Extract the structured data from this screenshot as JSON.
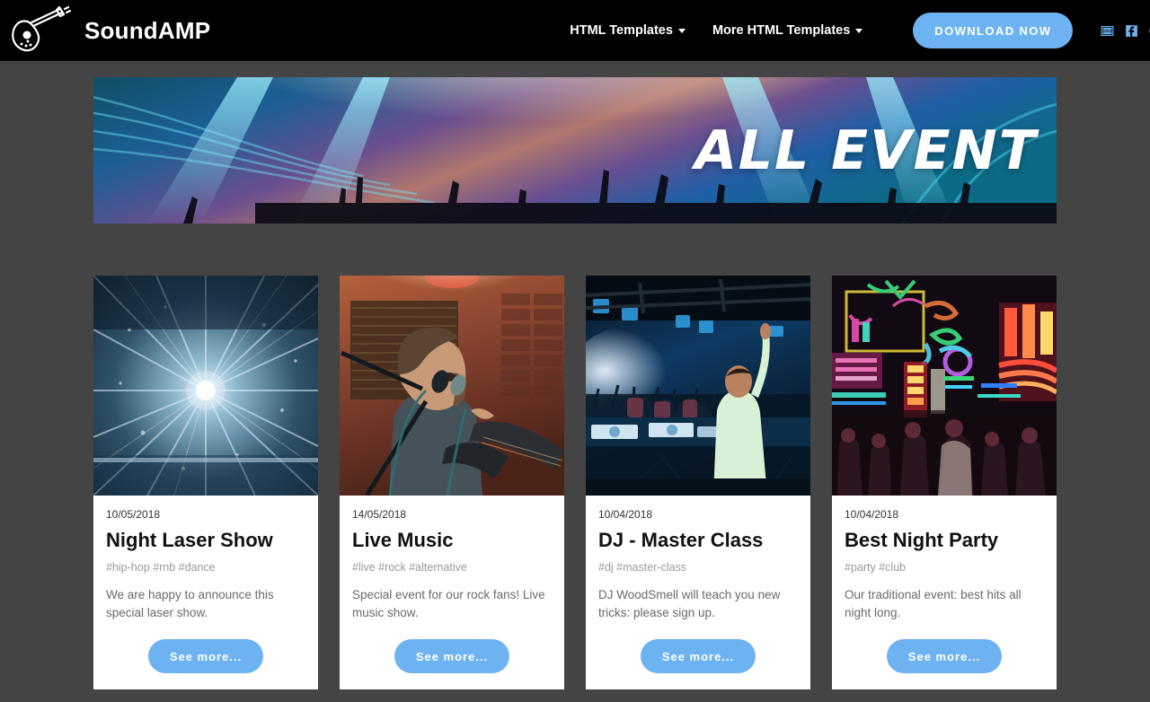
{
  "header": {
    "logo_icon": "guitar-icon",
    "brand": "SoundAMP",
    "nav": [
      {
        "label": "HTML Templates",
        "caret": true
      },
      {
        "label": "More HTML Templates",
        "caret": true
      }
    ],
    "download_label": "DOWNLOAD NOW",
    "socials": [
      {
        "name": "youtube-icon"
      },
      {
        "name": "facebook-icon"
      },
      {
        "name": "google-plus-icon"
      },
      {
        "name": "linkedin-icon"
      },
      {
        "name": "pinterest-icon"
      },
      {
        "name": "instagram-icon"
      },
      {
        "name": "twitter-icon"
      }
    ]
  },
  "hero": {
    "title": "ALL EVENT"
  },
  "cards": [
    {
      "date": "10/05/2018",
      "title": "Night Laser Show",
      "tags": "#hip-hop #rnb #dance",
      "desc": "We are happy to announce this special laser show.",
      "button": "See more...",
      "image_alt": "laser-light-burst-photo"
    },
    {
      "date": "14/05/2018",
      "title": "Live Music",
      "tags": "#live #rock #alternative",
      "desc": "Special event for our rock fans! Live music show.",
      "button": "See more...",
      "image_alt": "guitarist-singing-photo"
    },
    {
      "date": "10/04/2018",
      "title": "DJ - Master Class",
      "tags": "#dj #master-class",
      "desc": "DJ WoodSmell will teach you new tricks: please sign up.",
      "button": "See more...",
      "image_alt": "dj-facing-crowd-photo"
    },
    {
      "date": "10/04/2018",
      "title": "Best Night Party",
      "tags": "#party #club",
      "desc": "Our traditional event: best hits all night long.",
      "button": "See more...",
      "image_alt": "neon-night-street-photo"
    }
  ],
  "colors": {
    "page_background": "#444444",
    "header_background": "#000000",
    "accent_blue": "#6db3f2",
    "card_background": "#ffffff"
  }
}
